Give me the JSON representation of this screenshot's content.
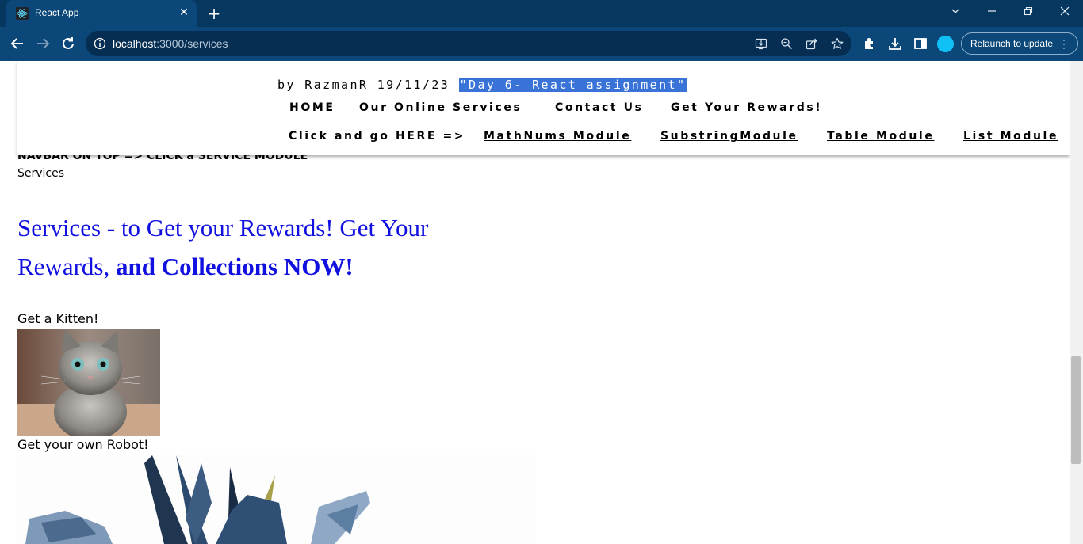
{
  "browser": {
    "tab_title": "React App",
    "url_host": "localhost",
    "url_rest": ":3000/services",
    "relaunch_label": "Relaunch to update"
  },
  "page": {
    "byline_prefix": "by RazmanR 19/11/23",
    "byline_highlight": "\"Day 6- React assignment\"",
    "nav_links": {
      "home": "HOME",
      "services": "Our Online Services",
      "contact": "Contact Us",
      "rewards": "Get Your Rewards!"
    },
    "module_prompt": "Click and go HERE =>",
    "module_links": {
      "mathnums": "MathNums Module",
      "substring": "SubstringModule",
      "table": "Table Module",
      "list": "List Module"
    },
    "behind_text": "NAVBAR ON TOP => CLICK a SERVICE MODULE",
    "services_label": "Services",
    "heading_normal": "Services - to Get your Rewards! Get Your Rewards, ",
    "heading_bold": "and Collections NOW!",
    "kitten_label": "Get a Kitten!",
    "robot_label": "Get your own Robot!"
  },
  "colors": {
    "tabbar": "#06375f",
    "toolbar": "#0b4778",
    "heading": "#1010e0",
    "highlight": "#3a73d8",
    "profile": "#0fc1f4"
  }
}
